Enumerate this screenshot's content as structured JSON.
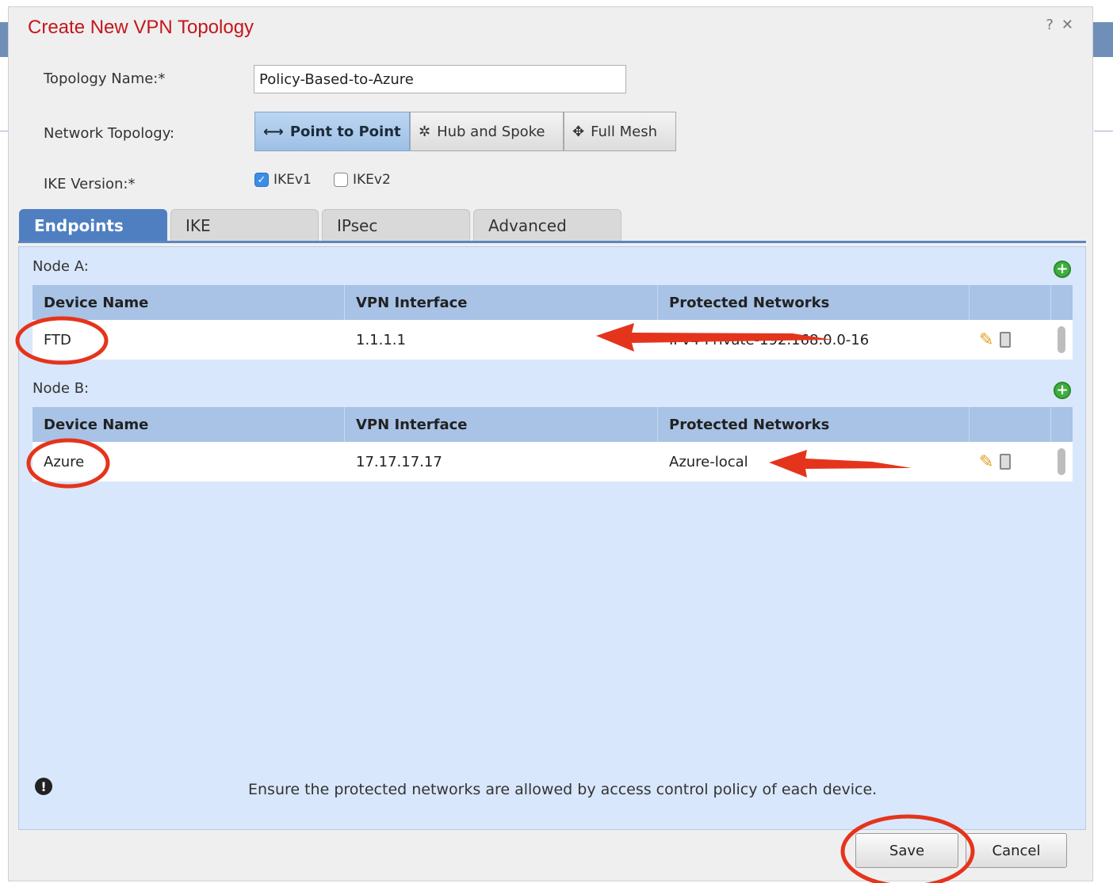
{
  "dialog": {
    "title": "Create New VPN Topology",
    "help_glyph": "?",
    "close_glyph": "✕"
  },
  "form": {
    "topology_name_label": "Topology Name:*",
    "topology_name_value": "Policy-Based-to-Azure",
    "network_topology_label": "Network Topology:",
    "topology_options": [
      {
        "label": "Point to Point",
        "icon": "point-to-point-icon",
        "selected": true
      },
      {
        "label": "Hub and Spoke",
        "icon": "hub-and-spoke-icon",
        "selected": false
      },
      {
        "label": "Full Mesh",
        "icon": "full-mesh-icon",
        "selected": false
      }
    ],
    "ike_version_label": "IKE Version:*",
    "ike_options": [
      {
        "label": "IKEv1",
        "checked": true
      },
      {
        "label": "IKEv2",
        "checked": false
      }
    ]
  },
  "tabs": [
    {
      "label": "Endpoints",
      "active": true
    },
    {
      "label": "IKE",
      "active": false
    },
    {
      "label": "IPsec",
      "active": false
    },
    {
      "label": "Advanced",
      "active": false
    }
  ],
  "columns": [
    "Device Name",
    "VPN Interface",
    "Protected Networks"
  ],
  "node_a": {
    "label": "Node A:",
    "rows": [
      {
        "device": "FTD",
        "interface": "1.1.1.1",
        "networks": "IPv4-Private-192.168.0.0-16"
      }
    ]
  },
  "node_b": {
    "label": "Node B:",
    "rows": [
      {
        "device": "Azure",
        "interface": "17.17.17.17",
        "networks": "Azure-local"
      }
    ]
  },
  "info_message": "Ensure the protected networks are allowed by access control policy of each device.",
  "footer": {
    "save_label": "Save",
    "cancel_label": "Cancel"
  },
  "annotation_color": "#e5341c",
  "accent_color": "#4f7fc0"
}
